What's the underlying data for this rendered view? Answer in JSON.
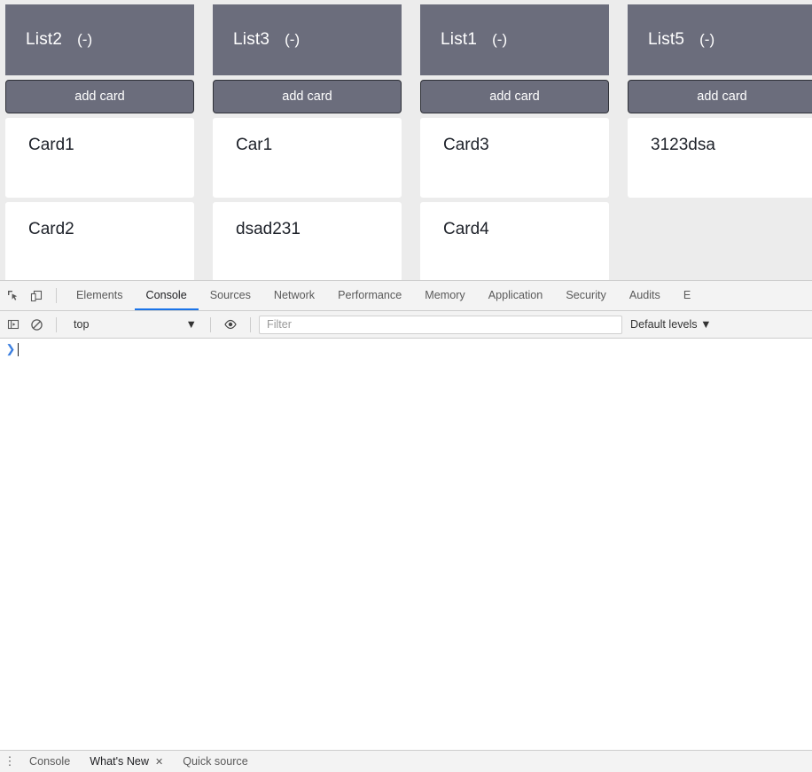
{
  "board": {
    "lists": [
      {
        "title": "List2",
        "remove_label": "(-)",
        "add_card_label": "add card",
        "cards": [
          {
            "text": "Card1"
          },
          {
            "text": "Card2"
          }
        ]
      },
      {
        "title": "List3",
        "remove_label": "(-)",
        "add_card_label": "add card",
        "cards": [
          {
            "text": "Car1"
          },
          {
            "text": "dsad231"
          }
        ]
      },
      {
        "title": "List1",
        "remove_label": "(-)",
        "add_card_label": "add card",
        "cards": [
          {
            "text": "Card3"
          },
          {
            "text": "Card4"
          }
        ]
      },
      {
        "title": "List5",
        "remove_label": "(-)",
        "add_card_label": "add card",
        "cards": [
          {
            "text": "3123dsa"
          }
        ]
      }
    ],
    "colors": {
      "background": "#ececec",
      "list_header": "#6b6d7c",
      "card": "#ffffff"
    }
  },
  "devtools": {
    "icons": {
      "inspect": "inspect-element-icon",
      "device": "device-toolbar-icon",
      "sidebar": "console-sidebar-icon",
      "clear": "clear-console-icon",
      "eye": "live-expression-eye-icon"
    },
    "tabs": [
      {
        "label": "Elements",
        "active": false
      },
      {
        "label": "Console",
        "active": true
      },
      {
        "label": "Sources",
        "active": false
      },
      {
        "label": "Network",
        "active": false
      },
      {
        "label": "Performance",
        "active": false
      },
      {
        "label": "Memory",
        "active": false
      },
      {
        "label": "Application",
        "active": false
      },
      {
        "label": "Security",
        "active": false
      },
      {
        "label": "Audits",
        "active": false
      },
      {
        "label": "E",
        "active": false
      }
    ],
    "active_tab_underline_color": "#1a73e8",
    "console_toolbar": {
      "context": "top",
      "context_caret": "▼",
      "filter_placeholder": "Filter",
      "filter_value": "",
      "levels": "Default levels",
      "levels_caret": "▼"
    },
    "console": {
      "prompt_symbol": "❯",
      "input_value": ""
    },
    "drawer": {
      "more_icon": "⋮",
      "tabs": [
        {
          "label": "Console",
          "closable": false,
          "active": false
        },
        {
          "label": "What's New",
          "closable": true,
          "close_label": "✕",
          "active": true
        },
        {
          "label": "Quick source",
          "closable": false,
          "active": false
        }
      ]
    }
  }
}
